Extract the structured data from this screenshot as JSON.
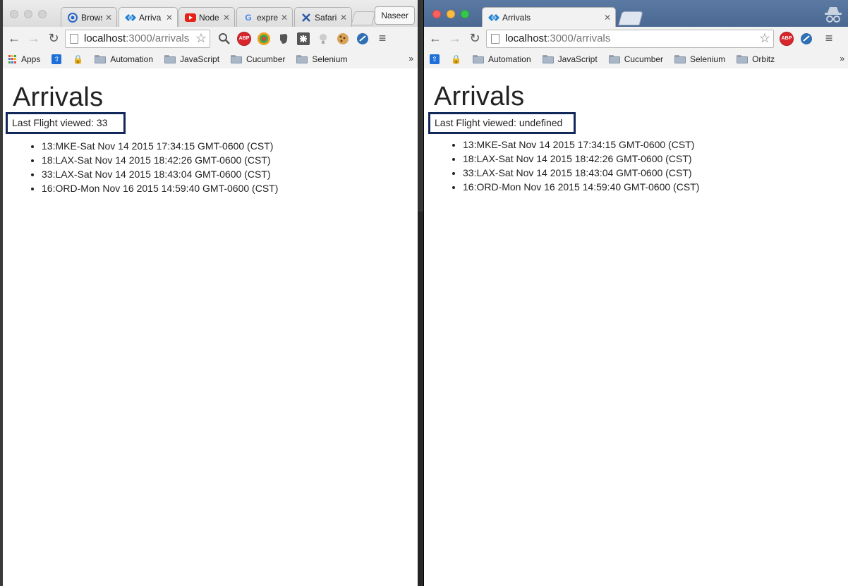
{
  "left_window": {
    "tabs": [
      {
        "label": "Brows",
        "icon": "chrome-icon"
      },
      {
        "label": "Arriva",
        "icon": "app-logo-icon",
        "active": true
      },
      {
        "label": "Node",
        "icon": "youtube-icon"
      },
      {
        "label": "expre",
        "icon": "google-icon"
      },
      {
        "label": "Safari",
        "icon": "safari-icon"
      }
    ],
    "profile_name": "Naseer",
    "url_host": "localhost",
    "url_path": ":3000/arrivals",
    "bookmarks": [
      "Apps",
      "Automation",
      "JavaScript",
      "Cucumber",
      "Selenium"
    ],
    "more_bookmarks": "»",
    "page": {
      "heading": "Arrivals",
      "last_flight": "Last Flight viewed: 33",
      "flights": [
        "13:MKE-Sat Nov 14 2015 17:34:15 GMT-0600 (CST)",
        "18:LAX-Sat Nov 14 2015 18:42:26 GMT-0600 (CST)",
        "33:LAX-Sat Nov 14 2015 18:43:04 GMT-0600 (CST)",
        "16:ORD-Mon Nov 16 2015 14:59:40 GMT-0600 (CST)"
      ]
    }
  },
  "right_window": {
    "mode": "incognito",
    "tabs": [
      {
        "label": "Arrivals",
        "icon": "app-logo-icon",
        "active": true
      }
    ],
    "url_host": "localhost",
    "url_path": ":3000/arrivals",
    "bookmarks": [
      "Automation",
      "JavaScript",
      "Cucumber",
      "Selenium",
      "Orbitz"
    ],
    "more_bookmarks": "»",
    "page": {
      "heading": "Arrivals",
      "last_flight": "Last Flight viewed: undefined",
      "flights": [
        "13:MKE-Sat Nov 14 2015 17:34:15 GMT-0600 (CST)",
        "18:LAX-Sat Nov 14 2015 18:42:26 GMT-0600 (CST)",
        "33:LAX-Sat Nov 14 2015 18:43:04 GMT-0600 (CST)",
        "16:ORD-Mon Nov 16 2015 14:59:40 GMT-0600 (CST)"
      ]
    }
  },
  "colors": {
    "highlight_box": "#12285a",
    "incognito_titlebar": "#4a6892"
  }
}
